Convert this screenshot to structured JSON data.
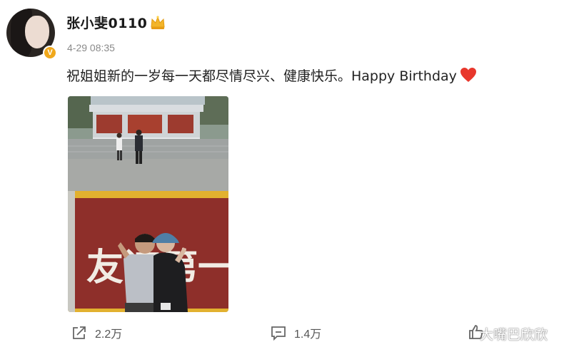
{
  "post": {
    "username": "张小斐0110",
    "timestamp": "4-29 08:35",
    "text": "祝姐姐新的一岁每一天都尽情尽兴、健康快乐。Happy Birthday",
    "verified_mark": "V"
  },
  "photo": {
    "sign_text": "友谊第一"
  },
  "actions": {
    "share_count": "2.2万",
    "comment_count": "1.4万"
  },
  "watermark": "大嘴巴欣欣",
  "icons": {
    "crown": "crown-icon",
    "heart": "heart-icon",
    "share": "share-icon",
    "comment": "comment-icon",
    "like": "like-icon"
  },
  "colors": {
    "verified": "#f0a81c",
    "heart": "#e8372c",
    "wall_red": "#8e2f2a",
    "frame_yellow": "#e2b12f"
  }
}
